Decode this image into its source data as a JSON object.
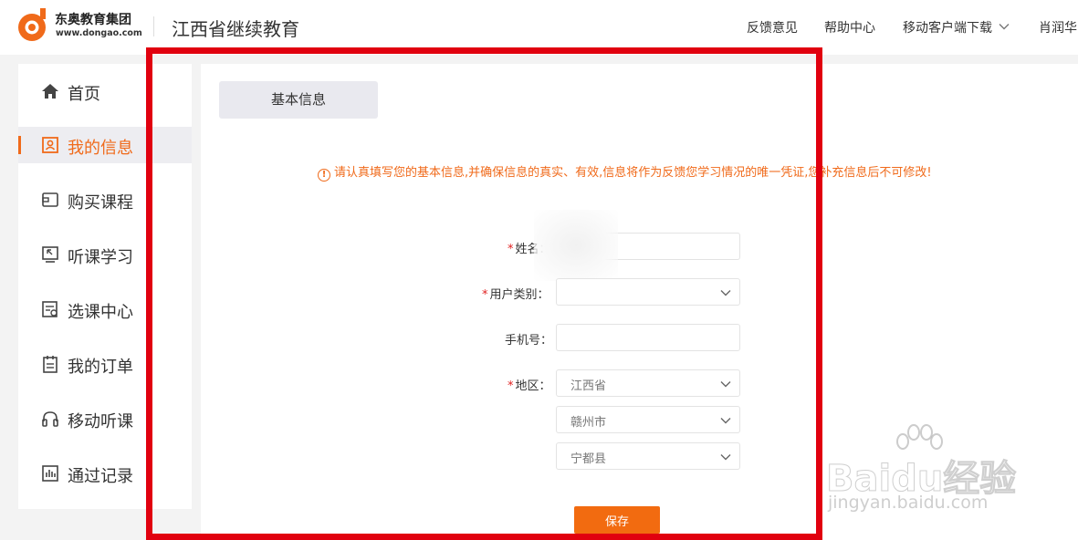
{
  "header": {
    "brand_name": "东奥教育集团",
    "brand_url": "www.dongao.com",
    "site_title": "江西省继续教育",
    "nav": {
      "feedback": "反馈意见",
      "help": "帮助中心",
      "mobile_download": "移动客户端下载",
      "user": "肖润华"
    }
  },
  "sidebar": {
    "items": [
      {
        "label": "首页",
        "icon": "home-icon"
      },
      {
        "label": "我的信息",
        "icon": "profile-icon",
        "active": true
      },
      {
        "label": "购买课程",
        "icon": "wallet-icon"
      },
      {
        "label": "听课学习",
        "icon": "play-screen-icon"
      },
      {
        "label": "选课中心",
        "icon": "course-select-icon"
      },
      {
        "label": "我的订单",
        "icon": "clipboard-icon"
      },
      {
        "label": "移动听课",
        "icon": "headphones-icon"
      },
      {
        "label": "通过记录",
        "icon": "bar-chart-icon"
      }
    ]
  },
  "main": {
    "tab_label": "基本信息",
    "notice": "请认真填写您的基本信息,并确保信息的真实、有效,信息将作为反馈您学习情况的唯一凭证,您补充信息后不可修改!",
    "form": {
      "name_label": "姓名：",
      "name_value": "",
      "user_type_label": "用户类别：",
      "user_type_value": "",
      "phone_label": "手机号：",
      "phone_value": "",
      "region_label": "地区：",
      "province": "江西省",
      "city": "赣州市",
      "county": "宁都县"
    },
    "save_label": "保存"
  },
  "watermark": {
    "main": "Baidu经验",
    "url": "jingyan.baidu.com"
  },
  "colors": {
    "accent": "#f06a1a",
    "annotation_red": "#e1000f",
    "required": "#e02020"
  }
}
